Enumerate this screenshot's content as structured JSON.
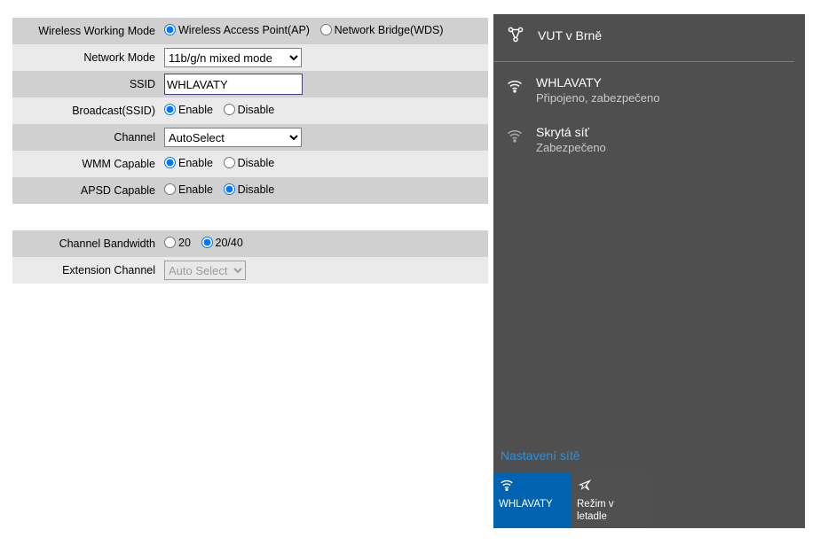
{
  "router": {
    "rows": {
      "wwm": {
        "label": "Wireless Working Mode",
        "opts": [
          "Wireless Access Point(AP)",
          "Network Bridge(WDS)"
        ]
      },
      "nm": {
        "label": "Network Mode",
        "select": "11b/g/n mixed mode"
      },
      "ssid": {
        "label": "SSID",
        "value": "WHLAVATY"
      },
      "bcast": {
        "label": "Broadcast(SSID)",
        "opts": [
          "Enable",
          "Disable"
        ]
      },
      "chan": {
        "label": "Channel",
        "select": "AutoSelect"
      },
      "wmm": {
        "label": "WMM Capable",
        "opts": [
          "Enable",
          "Disable"
        ]
      },
      "apsd": {
        "label": "APSD Capable",
        "opts": [
          "Enable",
          "Disable"
        ]
      },
      "cbw": {
        "label": "Channel Bandwidth",
        "opts": [
          "20",
          "20/40"
        ]
      },
      "ext": {
        "label": "Extension Channel",
        "select": "Auto Select"
      }
    }
  },
  "flyout": {
    "header": "VUT v Brně",
    "nets": [
      {
        "name": "WHLAVATY",
        "status": "Připojeno, zabezpečeno",
        "connected": true
      },
      {
        "name": "Skrytá síť",
        "status": "Zabezpečeno",
        "connected": false
      }
    ],
    "settings": "Nastavení sítě",
    "tiles": {
      "wifi": {
        "label": "WHLAVATY"
      },
      "airplane": {
        "line1": "Režim v",
        "line2": "letadle"
      }
    }
  }
}
